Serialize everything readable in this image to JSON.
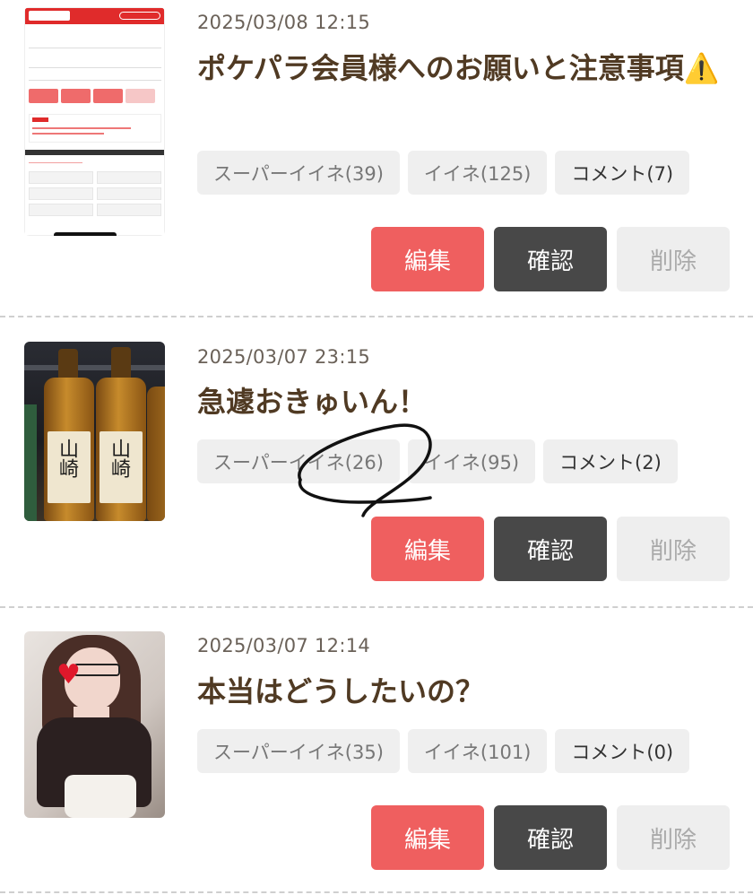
{
  "posts": [
    {
      "date": "2025/03/08 12:15",
      "title": "ポケパラ会員様へのお願いと注意事項⚠️",
      "tags": {
        "super_like": "スーパーイイネ(39)",
        "like": "イイネ(125)",
        "comment": "コメント(7)"
      },
      "buttons": {
        "edit": "編集",
        "confirm": "確認",
        "delete": "削除"
      }
    },
    {
      "date": "2025/03/07 23:15",
      "title": "急遽おきゅいん！",
      "tags": {
        "super_like": "スーパーイイネ(26)",
        "like": "イイネ(95)",
        "comment": "コメント(2)"
      },
      "buttons": {
        "edit": "編集",
        "confirm": "確認",
        "delete": "削除"
      }
    },
    {
      "date": "2025/03/07 12:14",
      "title": "本当はどうしたいの？",
      "tags": {
        "super_like": "スーパーイイネ(35)",
        "like": "イイネ(101)",
        "comment": "コメント(0)"
      },
      "buttons": {
        "edit": "編集",
        "confirm": "確認",
        "delete": "削除"
      }
    }
  ],
  "thumbnails": {
    "whisky_label": "山崎"
  },
  "colors": {
    "edit": "#ef5f5f",
    "confirm": "#484848",
    "delete": "#eeeeee",
    "title": "#503a23"
  }
}
